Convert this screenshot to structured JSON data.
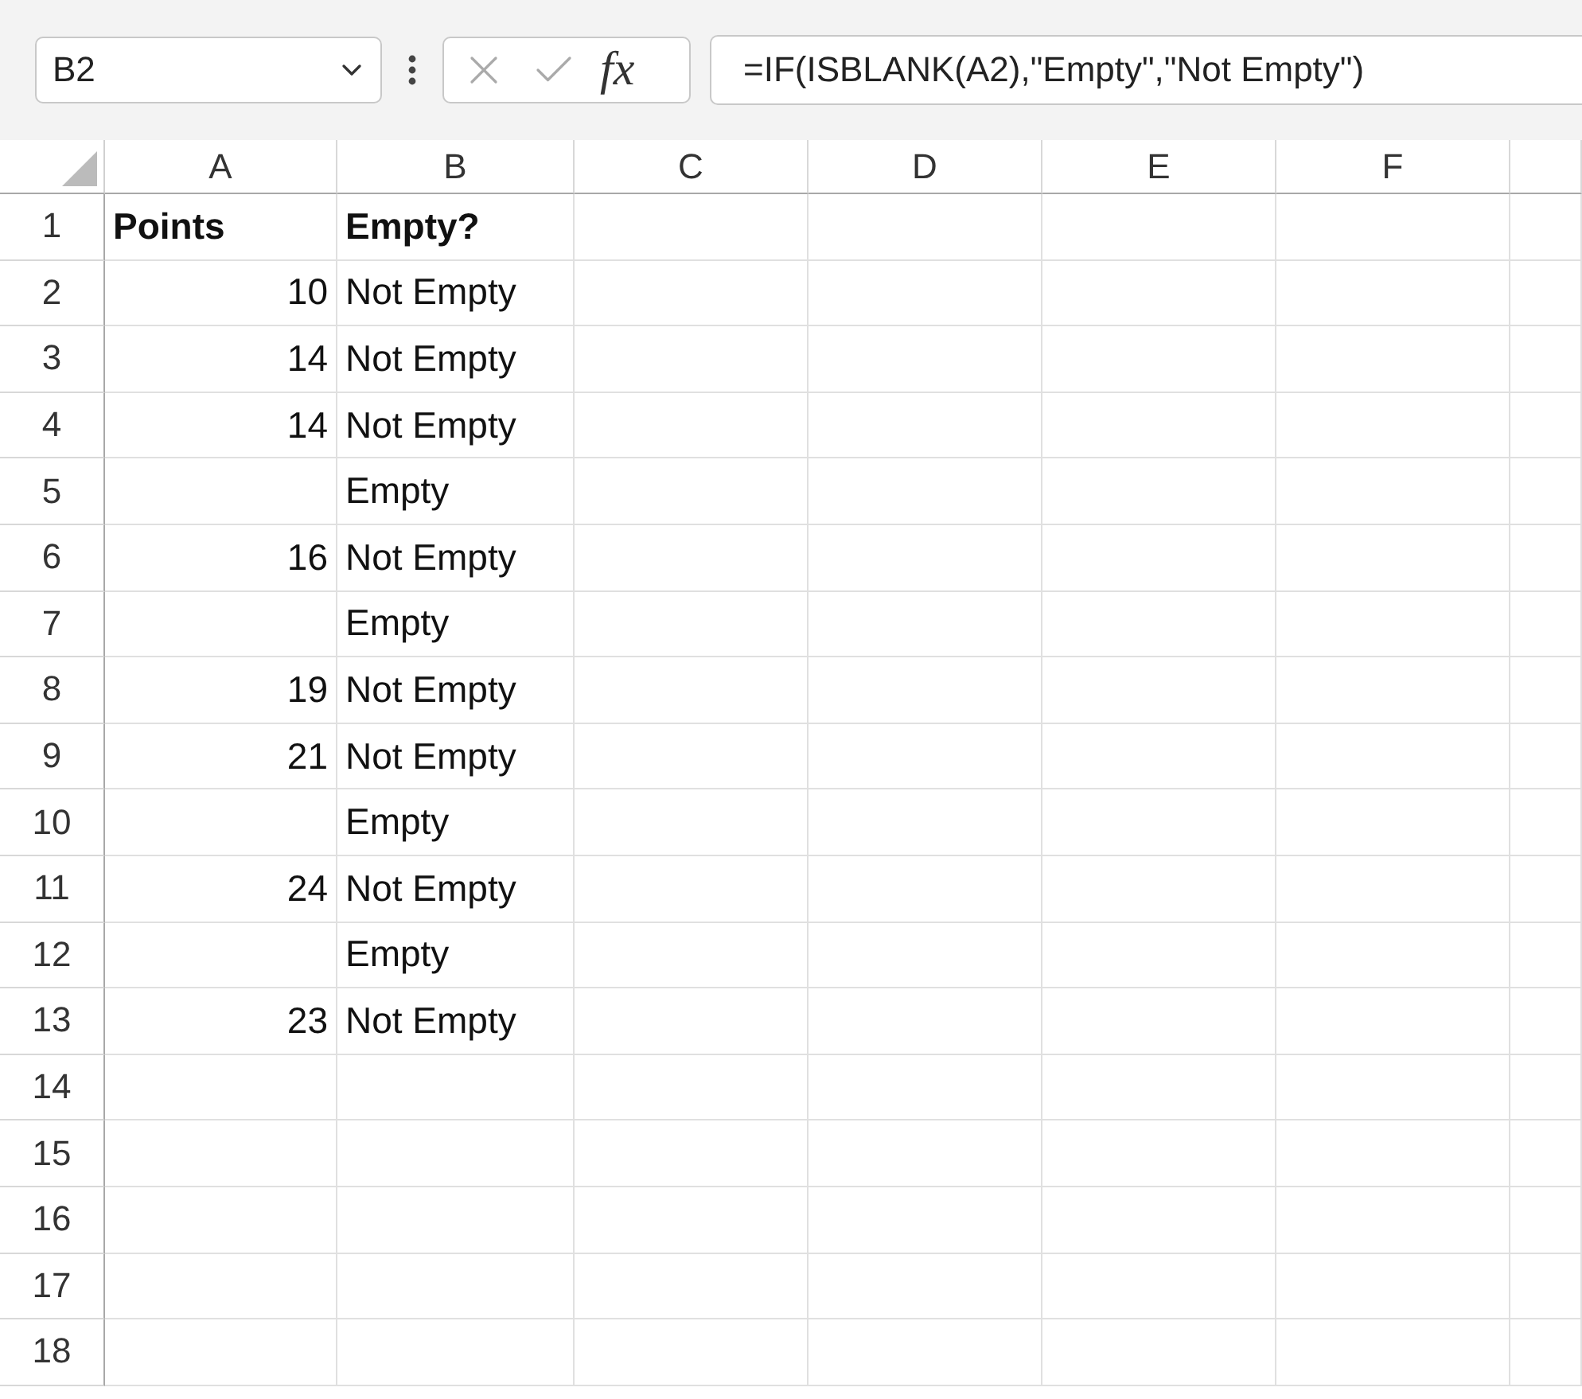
{
  "formula_bar": {
    "name_box": "B2",
    "fx_label": "fx",
    "formula": "=IF(ISBLANK(A2),\"Empty\",\"Not Empty\")"
  },
  "columns": [
    "A",
    "B",
    "C",
    "D",
    "E",
    "F"
  ],
  "rows": [
    {
      "number": "1",
      "kind": "header",
      "cells": [
        "Points",
        "Empty?"
      ]
    },
    {
      "number": "2",
      "kind": "data",
      "cells": [
        "10",
        "Not Empty"
      ]
    },
    {
      "number": "3",
      "kind": "data",
      "cells": [
        "14",
        "Not Empty"
      ]
    },
    {
      "number": "4",
      "kind": "data",
      "cells": [
        "14",
        "Not Empty"
      ]
    },
    {
      "number": "5",
      "kind": "data",
      "cells": [
        "",
        "Empty"
      ]
    },
    {
      "number": "6",
      "kind": "data",
      "cells": [
        "16",
        "Not Empty"
      ]
    },
    {
      "number": "7",
      "kind": "data",
      "cells": [
        "",
        "Empty"
      ]
    },
    {
      "number": "8",
      "kind": "data",
      "cells": [
        "19",
        "Not Empty"
      ]
    },
    {
      "number": "9",
      "kind": "data",
      "cells": [
        "21",
        "Not Empty"
      ]
    },
    {
      "number": "10",
      "kind": "data",
      "cells": [
        "",
        "Empty"
      ]
    },
    {
      "number": "11",
      "kind": "data",
      "cells": [
        "24",
        "Not Empty"
      ]
    },
    {
      "number": "12",
      "kind": "data",
      "cells": [
        "",
        "Empty"
      ]
    },
    {
      "number": "13",
      "kind": "data",
      "cells": [
        "23",
        "Not Empty"
      ]
    },
    {
      "number": "14",
      "kind": "data",
      "cells": []
    },
    {
      "number": "15",
      "kind": "data",
      "cells": []
    },
    {
      "number": "16",
      "kind": "data",
      "cells": []
    },
    {
      "number": "17",
      "kind": "data",
      "cells": []
    },
    {
      "number": "18",
      "kind": "data",
      "cells": []
    }
  ]
}
